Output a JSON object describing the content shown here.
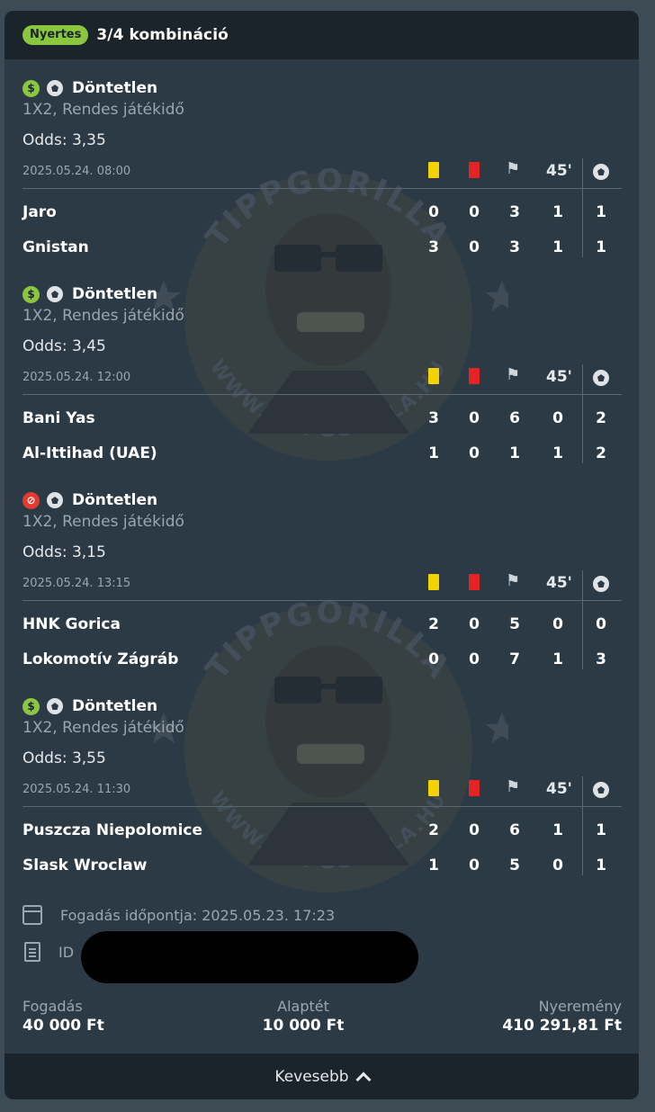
{
  "header": {
    "status_badge": "Nyertes",
    "title": "3/4 kombináció"
  },
  "watermark": {
    "text": "TIPPGORILLA",
    "url": "WWW.TIPPGORILLA.HU"
  },
  "column_headers": {
    "half": "45'"
  },
  "selections": [
    {
      "status": "win",
      "pick": "Döntetlen",
      "market": "1X2, Rendes játékidő",
      "odds": "Odds: 3,35",
      "datetime": "2025.05.24.  08:00",
      "teams": [
        {
          "name": "Jaro",
          "yellow": "0",
          "red": "0",
          "corners": "3",
          "half": "1",
          "goals": "1"
        },
        {
          "name": "Gnistan",
          "yellow": "3",
          "red": "0",
          "corners": "3",
          "half": "1",
          "goals": "1"
        }
      ]
    },
    {
      "status": "win",
      "pick": "Döntetlen",
      "market": "1X2, Rendes játékidő",
      "odds": "Odds: 3,45",
      "datetime": "2025.05.24.  12:00",
      "teams": [
        {
          "name": "Bani Yas",
          "yellow": "3",
          "red": "0",
          "corners": "6",
          "half": "0",
          "goals": "2"
        },
        {
          "name": "Al-Ittihad (UAE)",
          "yellow": "1",
          "red": "0",
          "corners": "1",
          "half": "1",
          "goals": "2"
        }
      ]
    },
    {
      "status": "lose",
      "pick": "Döntetlen",
      "market": "1X2, Rendes játékidő",
      "odds": "Odds: 3,15",
      "datetime": "2025.05.24.  13:15",
      "teams": [
        {
          "name": "HNK Gorica",
          "yellow": "2",
          "red": "0",
          "corners": "5",
          "half": "0",
          "goals": "0"
        },
        {
          "name": "Lokomotív Zágráb",
          "yellow": "0",
          "red": "0",
          "corners": "7",
          "half": "1",
          "goals": "3"
        }
      ]
    },
    {
      "status": "win",
      "pick": "Döntetlen",
      "market": "1X2, Rendes játékidő",
      "odds": "Odds: 3,55",
      "datetime": "2025.05.24.  11:30",
      "teams": [
        {
          "name": "Puszcza Niepolomice",
          "yellow": "2",
          "red": "0",
          "corners": "6",
          "half": "1",
          "goals": "1"
        },
        {
          "name": "Slask Wroclaw",
          "yellow": "1",
          "red": "0",
          "corners": "5",
          "half": "0",
          "goals": "1"
        }
      ]
    }
  ],
  "bet_info": {
    "placed_label": "Fogadás időpontja:",
    "placed_value": "2025.05.23.  17:23",
    "id_label": "ID"
  },
  "totals": {
    "stake_label": "Fogadás",
    "stake_value": "40 000 Ft",
    "base_label": "Alaptét",
    "base_value": "10 000 Ft",
    "win_label": "Nyeremény",
    "win_value": "410 291,81 Ft"
  },
  "toggle": {
    "label": "Kevesebb"
  }
}
